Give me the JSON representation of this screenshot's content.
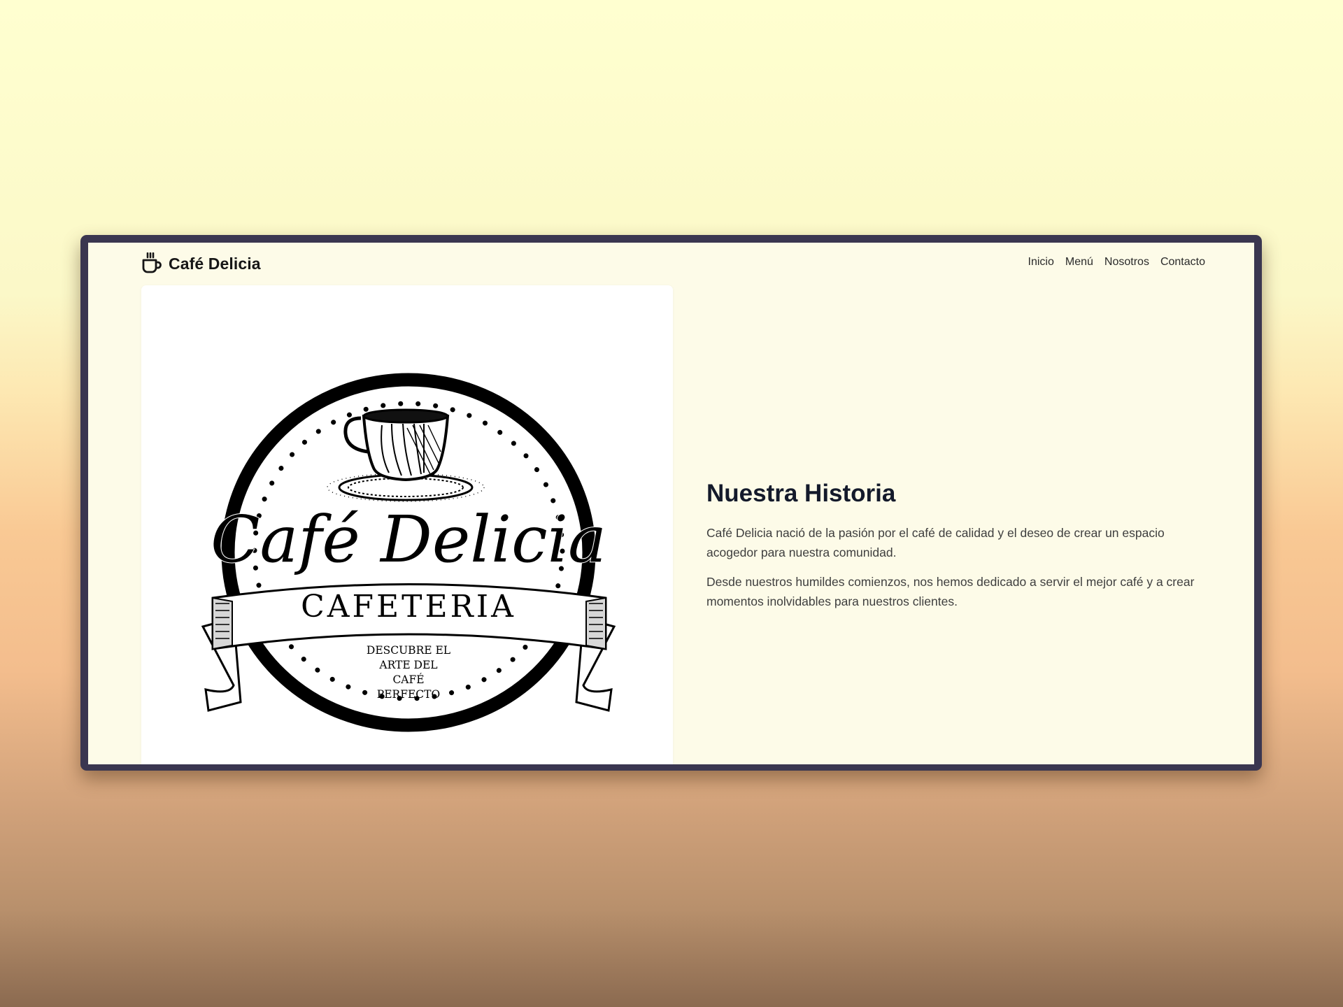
{
  "navbar": {
    "brand_icon": "coffee-cup-icon",
    "brand_name": "Café Delicia",
    "links": [
      "Inicio",
      "Menú",
      "Nosotros",
      "Contacto"
    ]
  },
  "logo": {
    "script_text": "Café Delicia",
    "banner_text": "CAFETERIA",
    "tagline_lines": [
      "DESCUBRE EL",
      "ARTE DEL",
      "CAFÉ",
      "PERFECTO"
    ]
  },
  "story": {
    "title": "Nuestra Historia",
    "paragraphs": [
      "Café Delicia nació de la pasión por el café de calidad y el deseo de crear un espacio acogedor para nuestra comunidad.",
      "Desde nuestros humildes comienzos, nos hemos dedicado a servir el mejor café y a crear momentos inolvidables para nuestros clientes."
    ]
  }
}
